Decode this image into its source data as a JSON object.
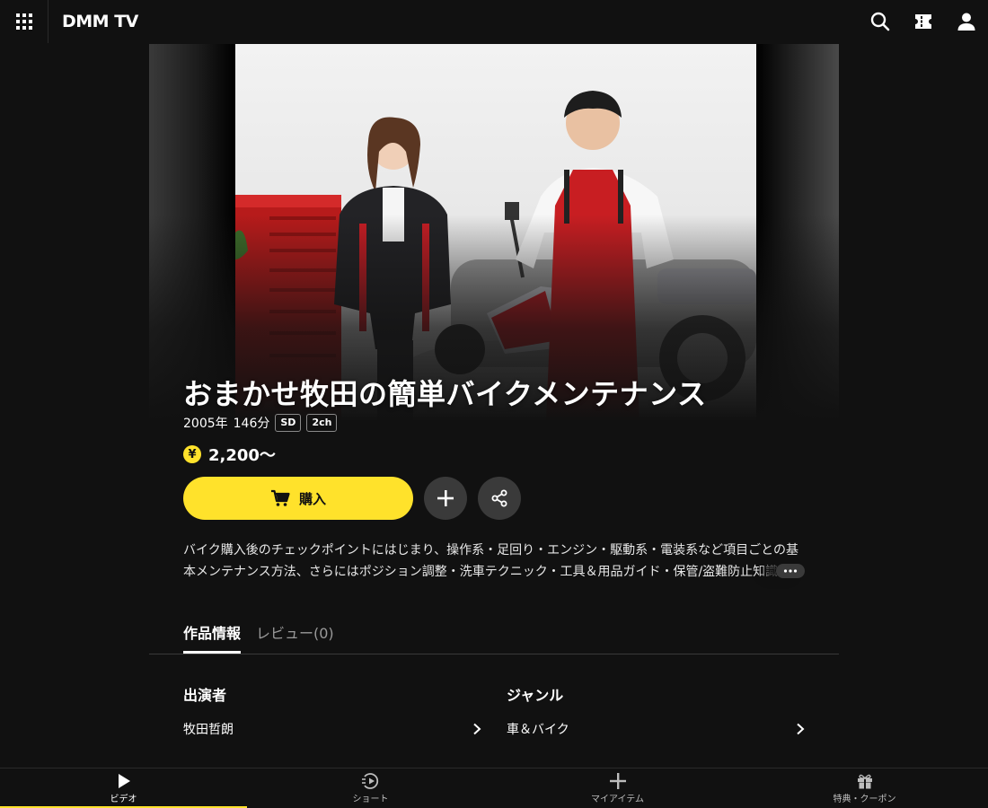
{
  "header": {
    "logo": "DMM TV",
    "icons": [
      "grid-menu-icon",
      "search-icon",
      "ticket-icon",
      "user-icon"
    ]
  },
  "content": {
    "title": "おまかせ牧田の簡単バイクメンテナンス",
    "year": "2005年",
    "duration": "146分",
    "badges": [
      "SD",
      "2ch"
    ],
    "price_symbol": "¥",
    "price": "2,200〜",
    "buy_label": "購入",
    "description": "バイク購入後のチェックポイントにはじまり、操作系・足回り・エンジン・駆動系・電装系など項目ごとの基本メンテナンス方法、さらにはポジション調整・洗車テクニック・工具＆用品ガイド・保管/盗難防止知識"
  },
  "tabs": [
    {
      "label": "作品情報",
      "active": true
    },
    {
      "label": "レビュー(0)",
      "active": false
    }
  ],
  "info": {
    "cast_heading": "出演者",
    "cast_value": "牧田哲朗",
    "genre_heading": "ジャンル",
    "genre_value": "車＆バイク"
  },
  "bottom_nav": [
    {
      "label": "ビデオ",
      "icon": "play-icon",
      "active": true
    },
    {
      "label": "ショート",
      "icon": "short-play-icon",
      "active": false
    },
    {
      "label": "マイアイテム",
      "icon": "plus-icon",
      "active": false
    },
    {
      "label": "特典・クーポン",
      "icon": "gift-icon",
      "active": false
    }
  ],
  "colors": {
    "background": "#111111",
    "accent": "#ffe22b",
    "button_dark": "#3a3a3a"
  }
}
